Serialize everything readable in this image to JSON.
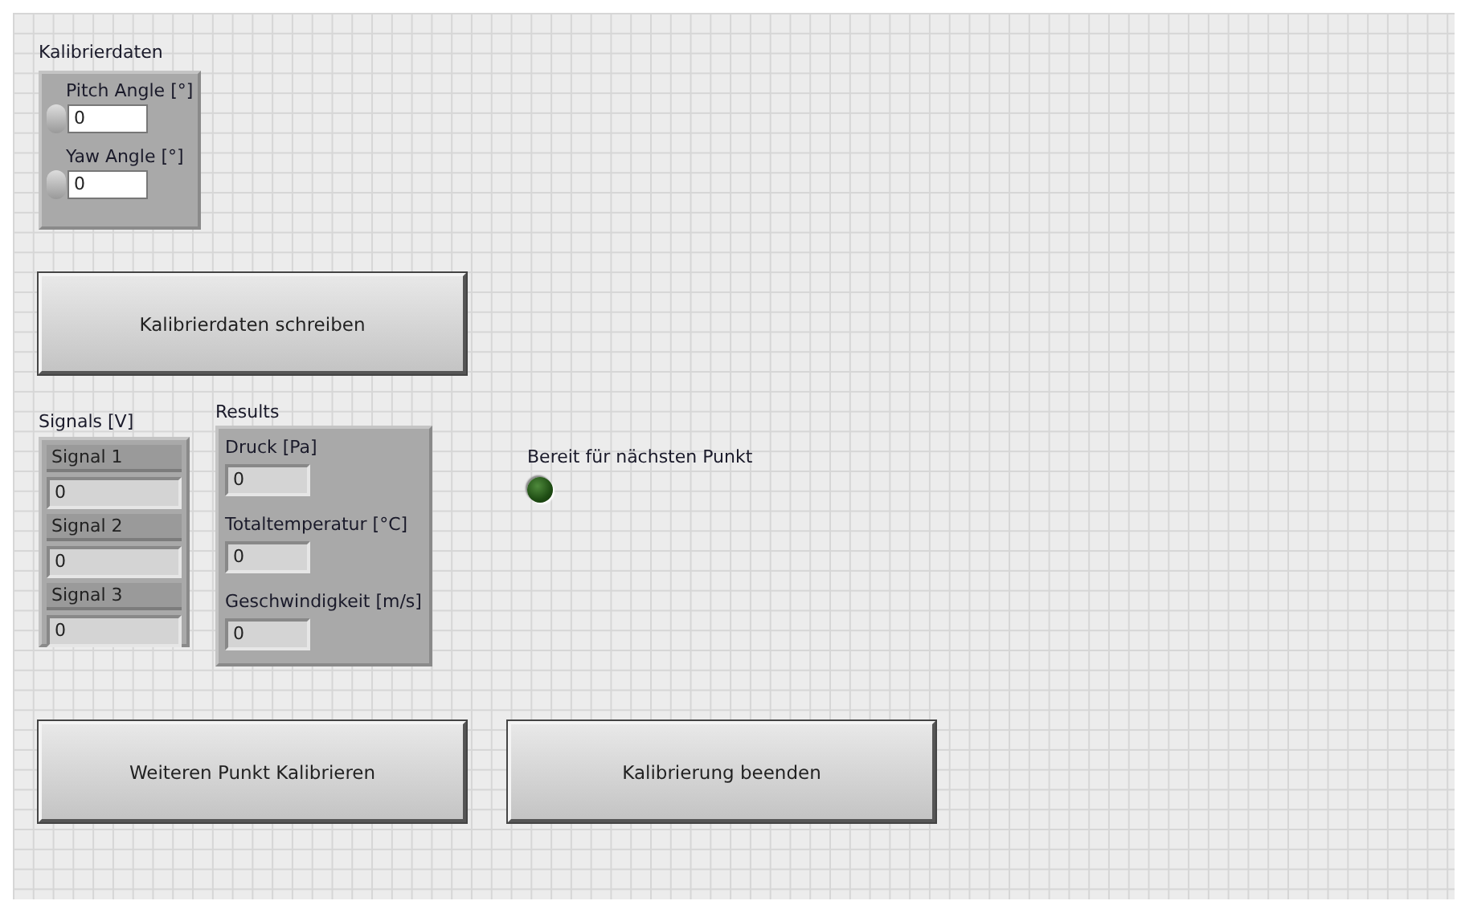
{
  "calibration": {
    "label": "Kalibrierdaten",
    "controls": [
      {
        "label": "Pitch Angle [°]",
        "value": "0"
      },
      {
        "label": "Yaw Angle [°]",
        "value": "0"
      }
    ]
  },
  "write_button": {
    "label": "Kalibrierdaten schreiben"
  },
  "signals": {
    "label": "Signals [V]",
    "items": [
      {
        "label": "Signal 1",
        "value": "0"
      },
      {
        "label": "Signal 2",
        "value": "0"
      },
      {
        "label": "Signal 3",
        "value": "0"
      }
    ]
  },
  "results": {
    "label": "Results",
    "items": [
      {
        "label": "Druck [Pa]",
        "value": "0"
      },
      {
        "label": "Totaltemperatur [°C]",
        "value": "0"
      },
      {
        "label": "Geschwindigkeit [m/s]",
        "value": "0"
      }
    ]
  },
  "ready_led": {
    "label": "Bereit für nächsten Punkt",
    "on": false
  },
  "buttons": [
    {
      "label": "Weiteren Punkt Kalibrieren"
    },
    {
      "label": "Kalibrierung beenden"
    }
  ]
}
